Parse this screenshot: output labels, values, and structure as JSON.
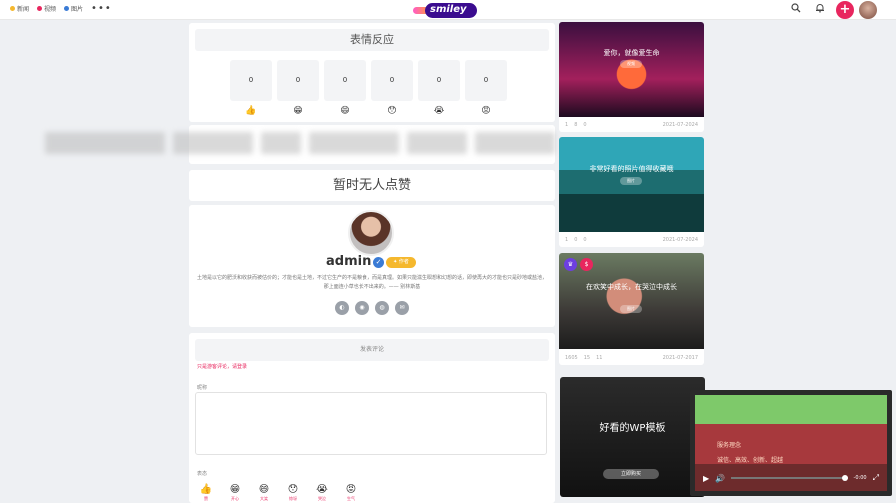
{
  "nav": {
    "items": [
      {
        "label": "新闻",
        "color": "#f5b82e"
      },
      {
        "label": "视频",
        "color": "#e8265e"
      },
      {
        "label": "图片",
        "color": "#3a7bd5"
      }
    ],
    "more": "•••"
  },
  "logo": {
    "text": "smiley"
  },
  "header": {
    "search_icon": "search-icon",
    "bell_icon": "bell-icon",
    "plus": "+"
  },
  "reactions": {
    "title": "表情反应",
    "items": [
      {
        "count": "0",
        "emoji": "👍"
      },
      {
        "count": "0",
        "emoji": "😁"
      },
      {
        "count": "0",
        "emoji": "😄"
      },
      {
        "count": "0",
        "emoji": "😯"
      },
      {
        "count": "0",
        "emoji": "😭"
      },
      {
        "count": "0",
        "emoji": "😡"
      }
    ]
  },
  "likes": {
    "empty": "暂时无人点赞"
  },
  "author": {
    "name": "admin",
    "verify": "✓",
    "badge": "✦ 作者",
    "bio": "土地是以它的肥沃和收获而被估价的；才能也是土地，不过它生产的不是粮食，而是真理。如果只能滋生瞑想和幻想的话，即使再大的才能也只是砂地或盐池，那上面连小草也长不出来的。—— 别林斯基",
    "social": [
      "◐",
      "◉",
      "◍",
      "✉"
    ]
  },
  "comment": {
    "title": "发表评论",
    "login_hint": "只是游客评论，请登录",
    "field_label": "昵称",
    "emoji_label": "表态",
    "emojis": [
      {
        "icon": "👍",
        "label": "赞"
      },
      {
        "icon": "😁",
        "label": "开心"
      },
      {
        "icon": "😄",
        "label": "大笑"
      },
      {
        "icon": "😯",
        "label": "惊讶"
      },
      {
        "icon": "😭",
        "label": "哭泣"
      },
      {
        "icon": "😡",
        "label": "生气"
      }
    ]
  },
  "posts": [
    {
      "title": "爱你，就像爱生命",
      "tag": "视频",
      "likes": "1",
      "views": "8",
      "comments": "0",
      "date": "2021-07-2024"
    },
    {
      "title": "非常好看的照片值得收藏哦",
      "tag": "图片",
      "likes": "1",
      "views": "0",
      "comments": "0",
      "date": "2021-07-2024"
    },
    {
      "title": "在欢笑中成长，在哭泣中成长",
      "tag": "图片",
      "likes": "1605",
      "views": "15",
      "comments": "11",
      "date": "2021-07-2017"
    },
    {
      "title": "好看的WP模板",
      "tag": "立即购买",
      "likes": "",
      "views": "",
      "comments": "",
      "date": ""
    }
  ],
  "player": {
    "line1": "服务理念",
    "line2": "诚信、高效、创新、超越",
    "time": "-0:00"
  }
}
